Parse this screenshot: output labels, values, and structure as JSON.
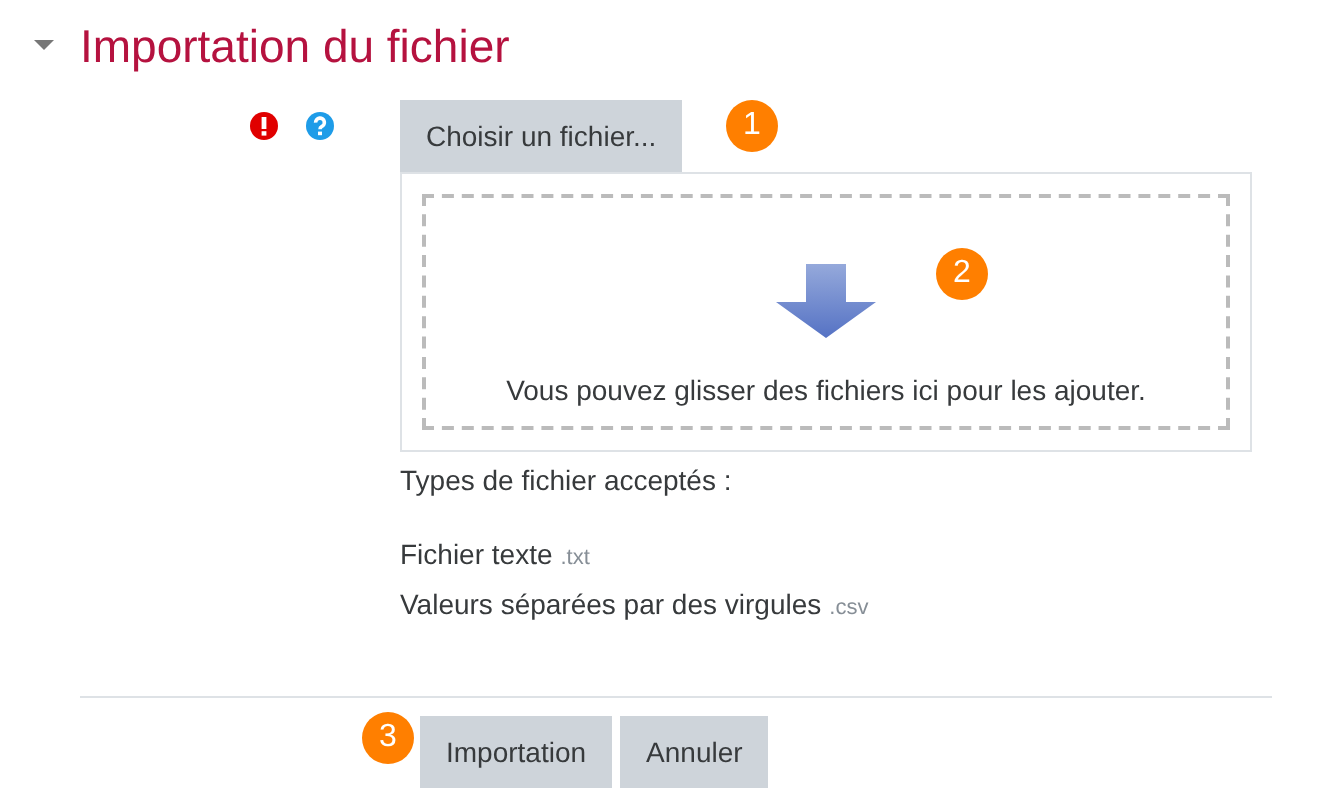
{
  "section": {
    "title": "Importation du fichier",
    "expanded": true
  },
  "file_picker": {
    "button": "Choisir un fichier...",
    "drop_hint": "Vous pouvez glisser des fichiers ici pour les ajouter."
  },
  "accepted_types": {
    "label": "Types de fichier acceptés :",
    "types": [
      {
        "name": "Fichier texte",
        "extension": ".txt"
      },
      {
        "name": "Valeurs séparées par des virgules",
        "extension": ".csv"
      }
    ]
  },
  "buttons": [
    {
      "label": "Importation"
    },
    {
      "label": "Annuler"
    }
  ],
  "callouts": [
    "1",
    "2",
    "3"
  ]
}
